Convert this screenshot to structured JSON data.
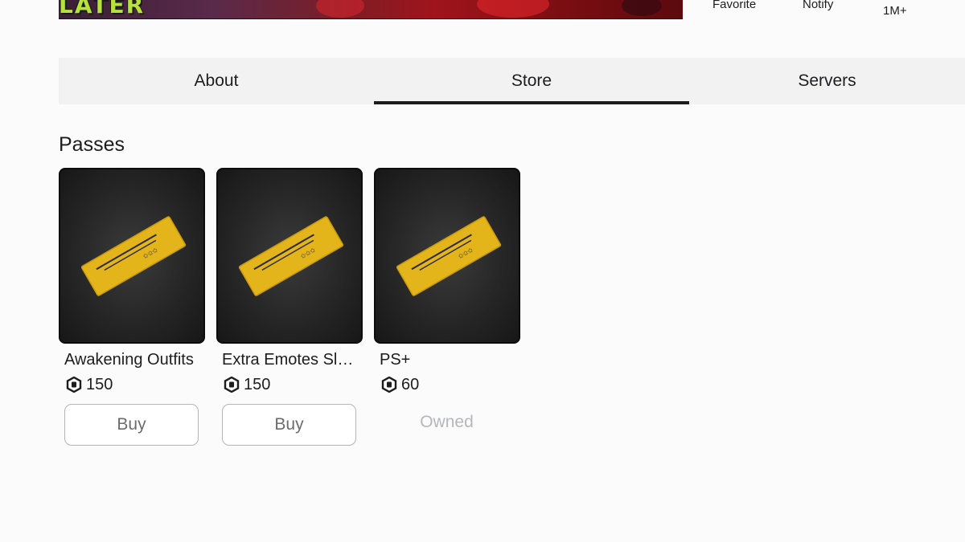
{
  "header": {
    "banner_logo_text": "LATER",
    "favorite_label": "Favorite",
    "notify_label": "Notify",
    "visits_count": "1M+"
  },
  "tabs": [
    {
      "label": "About",
      "active": false
    },
    {
      "label": "Store",
      "active": true
    },
    {
      "label": "Servers",
      "active": false
    }
  ],
  "section": {
    "title": "Passes"
  },
  "passes": [
    {
      "name": "Awakening Outfits",
      "price": "150",
      "action": "Buy",
      "owned": false
    },
    {
      "name": "Extra Emotes Slo...",
      "price": "150",
      "action": "Buy",
      "owned": false
    },
    {
      "name": "PS+",
      "price": "60",
      "action": "Owned",
      "owned": true
    }
  ],
  "colors": {
    "ticket_gold": "#e3b51a",
    "thumb_bg": "#262626",
    "active_tab_underline": "#1d1d1f",
    "owned_text": "#b5b7bc"
  },
  "icons": {
    "currency": "robux-icon",
    "pass_image": "gold-ticket-icon"
  }
}
